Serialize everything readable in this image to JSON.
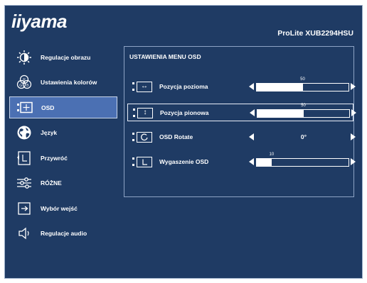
{
  "header": {
    "logo": "iiyama",
    "model": "ProLite XUB2294HSU"
  },
  "sidebar": {
    "items": [
      {
        "label": "Regulacje obrazu",
        "icon": "brightness-icon"
      },
      {
        "label": "Ustawienia kolorów",
        "icon": "rgb-icon"
      },
      {
        "label": "OSD",
        "icon": "osd-position-icon",
        "selected": true
      },
      {
        "label": "Język",
        "icon": "globe-icon"
      },
      {
        "label": "Przywróć",
        "icon": "reset-icon"
      },
      {
        "label": "RÓŻNE",
        "icon": "sliders-icon"
      },
      {
        "label": "Wybór wejść",
        "icon": "input-icon"
      },
      {
        "label": "Regulacje audio",
        "icon": "speaker-icon"
      }
    ]
  },
  "panel": {
    "title": "USTAWIENIA MENU OSD",
    "rows": [
      {
        "label": "Pozycja pozioma",
        "type": "slider",
        "value": 50,
        "max": 100,
        "display": "50",
        "icon": "horizontal-position-icon"
      },
      {
        "label": "Pozycja pionowa",
        "type": "slider",
        "value": 50,
        "max": 100,
        "display": "50",
        "icon": "vertical-position-icon",
        "selected": true
      },
      {
        "label": "OSD Rotate",
        "type": "value",
        "display": "0°",
        "icon": "rotate-icon"
      },
      {
        "label": "Wygaszenie OSD",
        "type": "slider",
        "value": 10,
        "max": 60,
        "display": "10",
        "icon": "timer-icon"
      }
    ]
  },
  "colors": {
    "background": "#1f3b64",
    "selected": "#4b70b3",
    "text": "#ffffff"
  }
}
